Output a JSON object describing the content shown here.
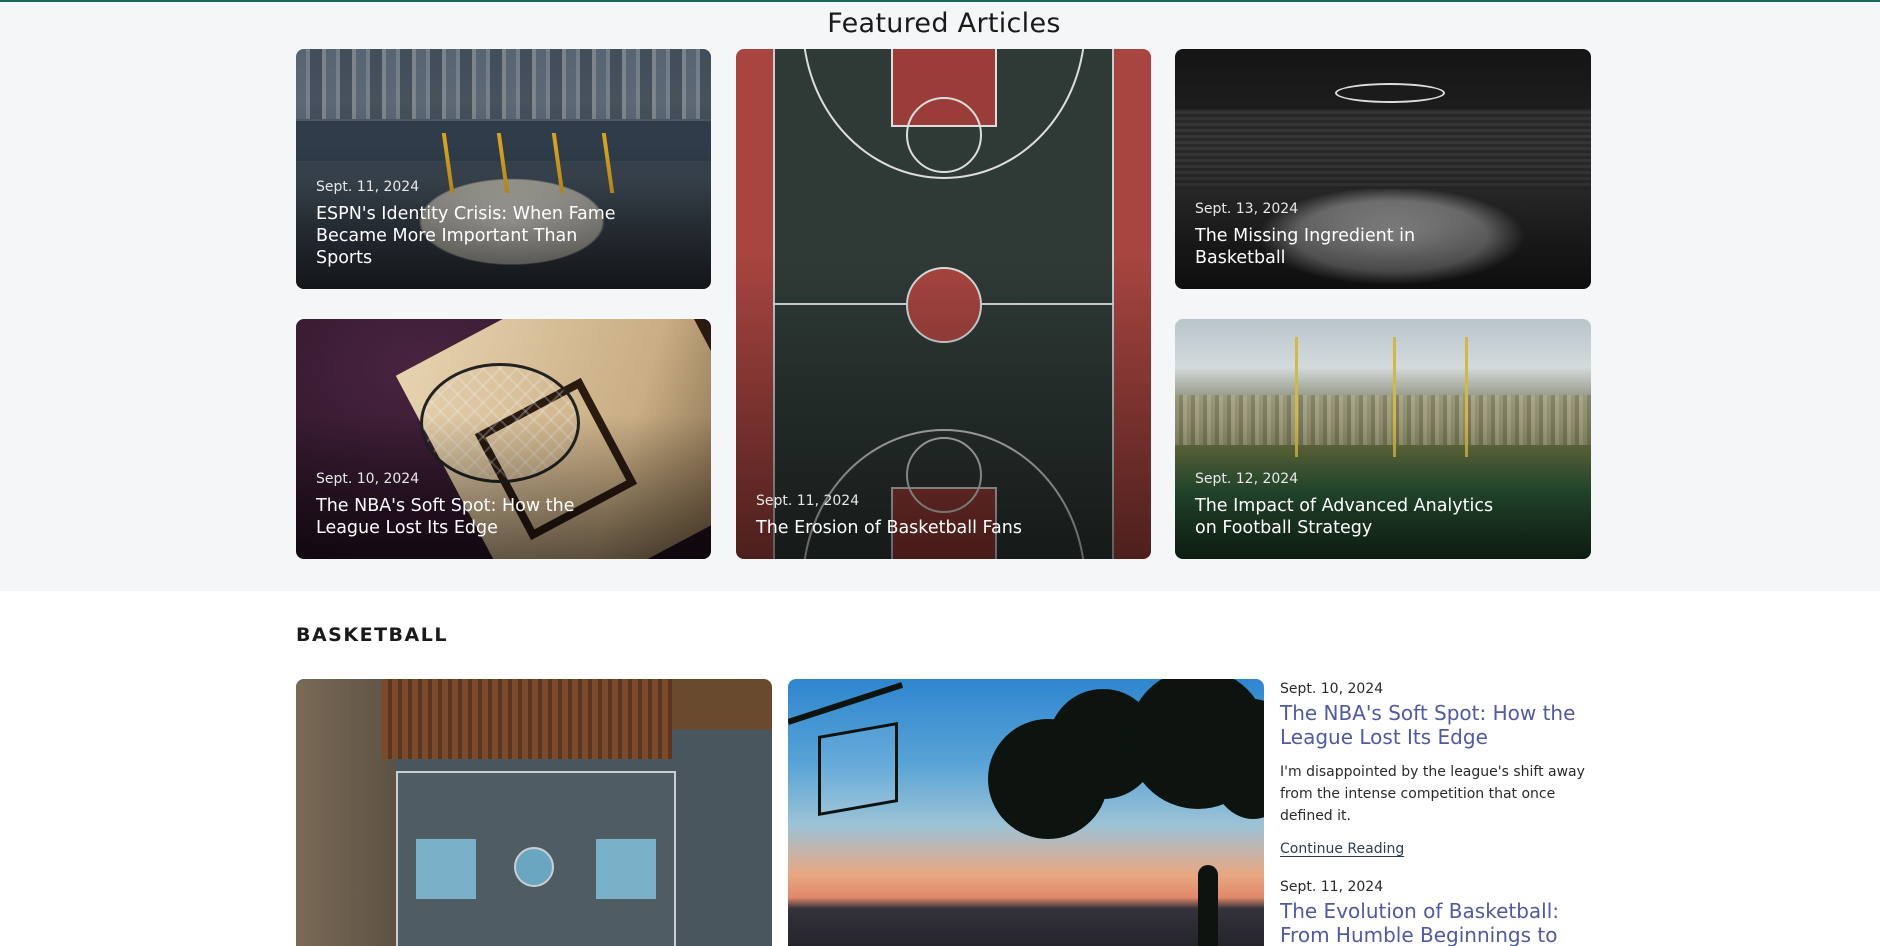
{
  "featured": {
    "heading": "Featured Articles",
    "cards": [
      {
        "date": "Sept. 11, 2024",
        "title": "ESPN's Identity Crisis: When Fame Became More Important Than Sports"
      },
      {
        "date": "Sept. 11, 2024",
        "title": "The Erosion of Basketball Fans"
      },
      {
        "date": "Sept. 13, 2024",
        "title": "The Missing Ingredient in Basketball"
      },
      {
        "date": "Sept. 10, 2024",
        "title": "The NBA's Soft Spot: How the League Lost Its Edge"
      },
      {
        "date": "Sept. 12, 2024",
        "title": "The Impact of Advanced Analytics on Football Strategy"
      }
    ]
  },
  "basketball": {
    "label": "BASKETBALL",
    "items": [
      {
        "date": "Sept. 10, 2024",
        "title": "The NBA's Soft Spot: How the League Lost Its Edge",
        "excerpt": "I'm disappointed by the league's shift away from the intense competition that once defined it.",
        "link": "Continue Reading"
      },
      {
        "date": "Sept. 11, 2024",
        "title": "The Evolution of Basketball: From Humble Beginnings to"
      }
    ]
  },
  "colors": {
    "accent": "#16695e",
    "link": "#4f5aa0"
  }
}
